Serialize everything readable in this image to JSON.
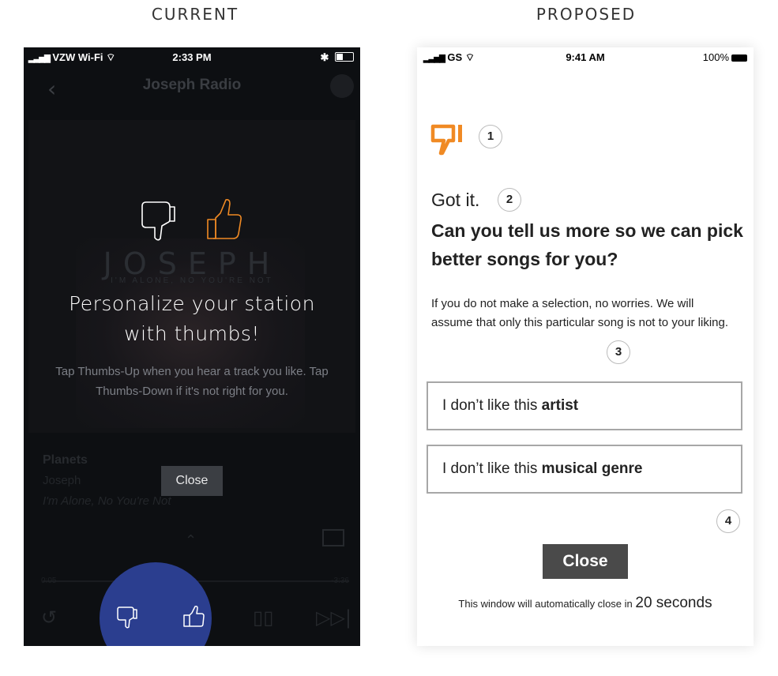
{
  "labels": {
    "current": "CURRENT",
    "proposed": "PROPOSED"
  },
  "current": {
    "status": {
      "carrier": "VZW Wi-Fi",
      "time": "2:33 PM"
    },
    "nav_title": "Joseph Radio",
    "album_text": "JOSEPH",
    "album_sub": "I'M ALONE, NO YOU'RE NOT",
    "overlay_title_1": "Personalize your station",
    "overlay_title_2": "with thumbs!",
    "overlay_body": "Tap Thumbs-Up when you hear a track you like. Tap Thumbs-Down if it's not right for you.",
    "track_title": "Planets",
    "track_artist": "Joseph",
    "track_album": "I'm Alone, No You're Not",
    "time_elapsed": "0:05",
    "time_remaining": "-3:36",
    "close_label": "Close",
    "colors": {
      "accent": "#f08a24",
      "overlay_bg": "#0d0f12",
      "circle": "#2b3e8f"
    }
  },
  "proposed": {
    "status": {
      "carrier": "GS",
      "time": "9:41 AM",
      "battery": "100%"
    },
    "callouts": [
      "1",
      "2",
      "3",
      "4"
    ],
    "got_it": "Got it.",
    "headline": "Can you tell us more so we can pick better songs for you?",
    "description": "If you do not make a selection, no worries. We will assume that only this particular song is not to your liking.",
    "options": [
      {
        "prefix": "I don’t like this ",
        "bold": "artist"
      },
      {
        "prefix": "I don’t like this ",
        "bold": "musical genre"
      }
    ],
    "close_label": "Close",
    "auto_close_text": "This window will automatically close in",
    "auto_close_seconds": "20 seconds",
    "colors": {
      "accent": "#f08a24",
      "close_btn": "#4a4a4a"
    }
  }
}
